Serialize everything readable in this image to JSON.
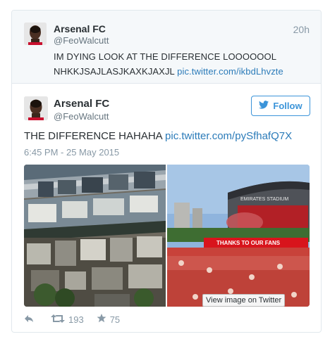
{
  "quoted": {
    "name": "Arsenal FC",
    "handle": "@FeoWalcutt",
    "time": "20h",
    "text_line1": "IM DYING LOOK AT THE DIFFERENCE LOOOOOOL",
    "text_line2": "NHKKJSAJLASJKAXKJAXJL",
    "link": "pic.twitter.com/ikbdLhvzte"
  },
  "tweet": {
    "name": "Arsenal FC",
    "handle": "@FeoWalcutt",
    "follow_label": "Follow",
    "text": "THE DIFFERENCE HAHAHA",
    "link": "pic.twitter.com/pySfhafQ7X",
    "timestamp": "6:45 PM - 25 May 2015",
    "view_image_label": "View image on Twitter",
    "banner_text": "THANKS TO OUR FANS",
    "stadium_text": "EMIRATES STADIUM",
    "retweets": "193",
    "favorites": "75"
  },
  "colors": {
    "link": "#2b7bb9",
    "follow_blue": "#3b94d9",
    "muted": "#8899a6",
    "arsenal_red": "#d8141c"
  },
  "icons": [
    "reply-icon",
    "retweet-icon",
    "favorite-icon",
    "twitter-bird-icon"
  ]
}
